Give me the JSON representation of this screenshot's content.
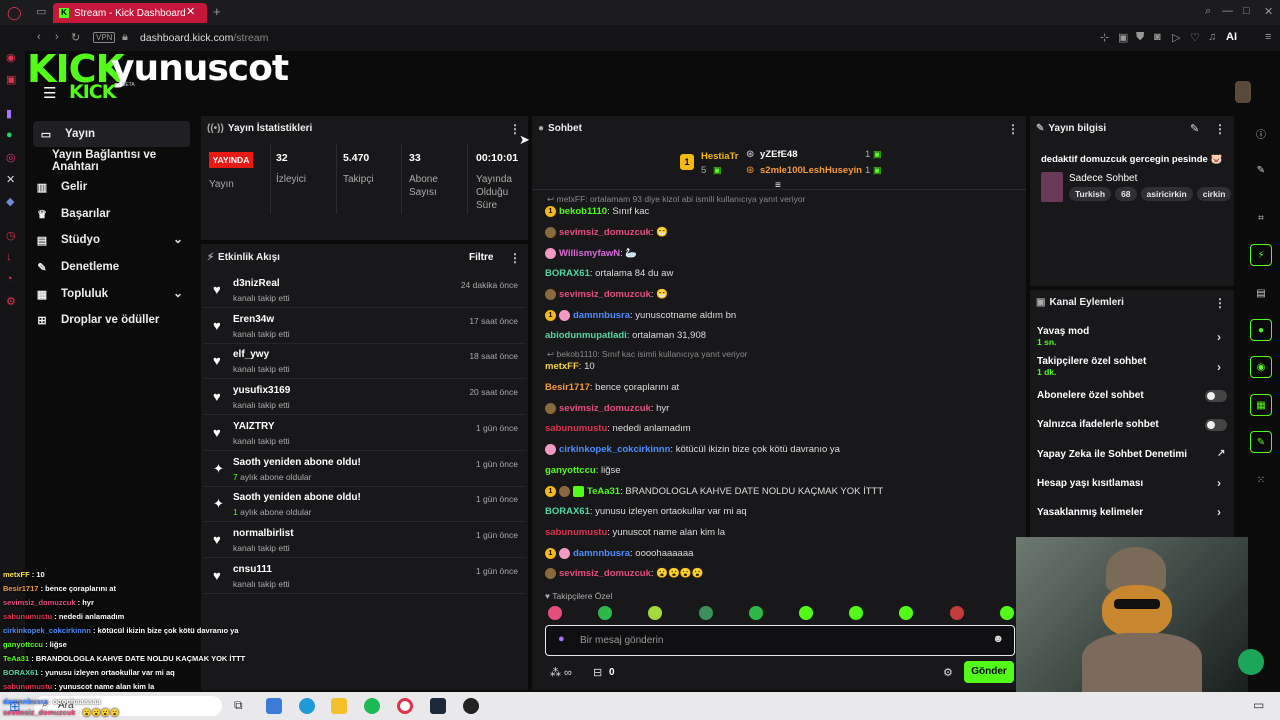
{
  "browser": {
    "tab_title": "Stream - Kick Dashboard",
    "url_domain": "dashboard.kick.com",
    "url_path": "/stream",
    "vpn_label": "VPN",
    "ai_label": "AI"
  },
  "header": {
    "logo_text": "KICK",
    "channel": "yunuscot",
    "beta_label": "BETA"
  },
  "nav": {
    "items": [
      {
        "label": "Yayın",
        "icon": "tv-icon"
      },
      {
        "label": "Yayın Bağlantısı ve Anahtarı",
        "icon": "none"
      },
      {
        "label": "Gelir",
        "icon": "chart-icon"
      },
      {
        "label": "Başarılar",
        "icon": "trophy-icon"
      },
      {
        "label": "Stüdyo",
        "icon": "studio-icon"
      },
      {
        "label": "Denetleme",
        "icon": "wrench-icon"
      },
      {
        "label": "Topluluk",
        "icon": "community-icon"
      },
      {
        "label": "Droplar ve ödüller",
        "icon": "gift-icon"
      }
    ]
  },
  "stats": {
    "title": "Yayın İstatistikleri",
    "live_badge": "YAYINDA",
    "live_label": "Yayın",
    "viewers_value": "32",
    "viewers_label": "İzleyici",
    "followers_value": "5.470",
    "followers_label": "Takipçi",
    "subs_value": "33",
    "subs_label1": "Abone",
    "subs_label2": "Sayısı",
    "uptime_value": "00:10:01",
    "uptime_label1": "Yayında",
    "uptime_label2": "Olduğu",
    "uptime_label3": "Süre"
  },
  "activity": {
    "title": "Etkinlik Akışı",
    "filter": "Filtre",
    "rows": [
      {
        "name": "d3nizReal",
        "sub": "kanalı takip etti",
        "time": "24 dakika önce",
        "type": "follow"
      },
      {
        "name": "Eren34w",
        "sub": "kanalı takip etti",
        "time": "17 saat önce",
        "type": "follow"
      },
      {
        "name": "elf_ywy",
        "sub": "kanalı takip etti",
        "time": "18 saat önce",
        "type": "follow"
      },
      {
        "name": "yusufix3169",
        "sub": "kanalı takip etti",
        "time": "20 saat önce",
        "type": "follow"
      },
      {
        "name": "YAIZTRY",
        "sub": "kanalı takip etti",
        "time": "1 gün önce",
        "type": "follow"
      },
      {
        "name": "Saoth yeniden abone oldu!",
        "sub_num": "7",
        "sub": " aylık abone oldular",
        "time": "1 gün önce",
        "type": "sub"
      },
      {
        "name": "Saoth yeniden abone oldu!",
        "sub_num": "1",
        "sub": " aylık abone oldular",
        "time": "1 gün önce",
        "type": "sub"
      },
      {
        "name": "normalbirlist",
        "sub": "kanalı takip etti",
        "time": "1 gün önce",
        "type": "follow"
      },
      {
        "name": "cnsu111",
        "sub": "kanalı takip etti",
        "time": "1 gün önce",
        "type": "follow"
      }
    ]
  },
  "chat": {
    "title": "Sohbet",
    "top_gifters": [
      {
        "name": "HestiaTr",
        "count": "5"
      },
      {
        "name": "yZEfE48",
        "count": "1"
      },
      {
        "name": "s2mle100LeshHuseyin",
        "count": "1"
      }
    ],
    "truncated_reply": "metxFF: ortalamam 93 diye kizol abi ismili kullanıcıya yanıt veriyor",
    "messages": [
      {
        "user": "bekob1110",
        "color": "#53fc18",
        "text": ": Sınıf kac"
      },
      {
        "user": "sevimsiz_domuzcuk",
        "color": "#e54d7c",
        "text": ": 😁"
      },
      {
        "user": "WillismyfawN",
        "color": "#d86ad8",
        "text": ": 🦢"
      },
      {
        "user": "BORAX61",
        "color": "#53d7a0",
        "text": ": ortalama 84 du aw"
      },
      {
        "user": "sevimsiz_domuzcuk",
        "color": "#e54d7c",
        "text": ": 😁"
      },
      {
        "user": "damnnbusra",
        "color": "#4c8dff",
        "text": ": yunuscotname aldım bn"
      },
      {
        "user": "abiodunmupatladi",
        "color": "#53d7a0",
        "text": ": ortalaman 31,908"
      },
      {
        "user": "metxFF",
        "color": "#f5d142",
        "text": ": 10"
      },
      {
        "user": "Besir1717",
        "color": "#f49a3c",
        "text": ": bence çoraplarını at"
      },
      {
        "user": "sevimsiz_domuzcuk",
        "color": "#e54d7c",
        "text": ": hyr"
      },
      {
        "user": "sabunumustu",
        "color": "#e2334d",
        "text": ": nededi anlamadım"
      },
      {
        "user": "cirkinkopek_cokcirkinnn",
        "color": "#4c8dff",
        "text": ": kötücül ikizin bize çok kötü davranıo ya"
      },
      {
        "user": "ganyottccu",
        "color": "#53fc18",
        "text": ": liğse"
      },
      {
        "user": "TeAa31",
        "color": "#53fc18",
        "text": ": BRANDOLOGLA KAHVE DATE NOLDU KAÇMAK YOK İTTT"
      },
      {
        "user": "BORAX61",
        "color": "#53d7a0",
        "text": ": yunusu izleyen ortaokullar var mi aq"
      },
      {
        "user": "sabunumustu",
        "color": "#e2334d",
        "text": ": yunuscot name alan kim la"
      },
      {
        "user": "damnnbusra",
        "color": "#4c8dff",
        "text": ": oooohaaaaaa"
      },
      {
        "user": "sevimsiz_domuzcuk",
        "color": "#e54d7c",
        "text": ": 😮😮😮😮"
      }
    ],
    "reply2": "bekob1110: Sınıf kac isimli kullanıcıya yanıt veriyor",
    "followers_only": "Takipçilere Özel",
    "input_placeholder": "Bir mesaj gönderin",
    "points": "0",
    "send": "Gönder"
  },
  "stream_info": {
    "title": "Yayın bilgisi",
    "stream_title": "dedaktif domuzcuk gercegin pesinde 🐷",
    "category": "Sadece Sohbet",
    "tags": [
      "Turkish",
      "68",
      "asiricirkin",
      "cirkin"
    ]
  },
  "channel_actions": {
    "title": "Kanal Eylemleri",
    "slow_mode": "Yavaş mod",
    "slow_value": "1 sn.",
    "followers_chat": "Takipçilere özel sohbet",
    "followers_value": "1 dk.",
    "subs_chat": "Abonelere özel sohbet",
    "emote_chat": "Yalnızca ifadelerle sohbet",
    "ai_mod": "Yapay Zeka ile Sohbet Denetimi",
    "age_limit": "Hesap yaşı kısıtlaması",
    "banned_words": "Yasaklanmış kelimeler"
  },
  "overlay_chat": [
    {
      "user": "metxFF",
      "color": "#ffe25c",
      "text": " : 10"
    },
    {
      "user": "Besir1717",
      "color": "#f49a3c",
      "text": " : bence çoraplarını at"
    },
    {
      "user": "sevimsiz_domuzcuk",
      "color": "#e54d7c",
      "text": " : hyr"
    },
    {
      "user": "sabunumustu",
      "color": "#e2334d",
      "text": " : nededi anlamadım"
    },
    {
      "user": "cirkinkopek_cokcirkinnn",
      "color": "#4c8dff",
      "text": " : kötücül ikizin bize çok kötü davranıo ya"
    },
    {
      "user": "ganyottccu",
      "color": "#53fc18",
      "text": " : liğse"
    },
    {
      "user": "TeAa31",
      "color": "#53fc18",
      "text": " : BRANDOLOGLA KAHVE DATE NOLDU KAÇMAK YOK İTTT"
    },
    {
      "user": "BORAX61",
      "color": "#53d7a0",
      "text": " : yunusu izleyen ortaokullar var mi aq"
    },
    {
      "user": "sabunumustu",
      "color": "#e2334d",
      "text": " : yunuscot name alan kim la"
    }
  ],
  "taskbar": {
    "search_label": "Ara",
    "overlay_tail_user": "sevimsiz_domuzcuk",
    "overlay_tail_text": ": 😮😮😮😮",
    "overlay_tail_user2": "damnnbusra",
    "overlay_tail_text2": ": oooohaaaaaa"
  },
  "colors": {
    "brand": "#53fc18",
    "panel": "#18181b",
    "live": "#e91916"
  }
}
